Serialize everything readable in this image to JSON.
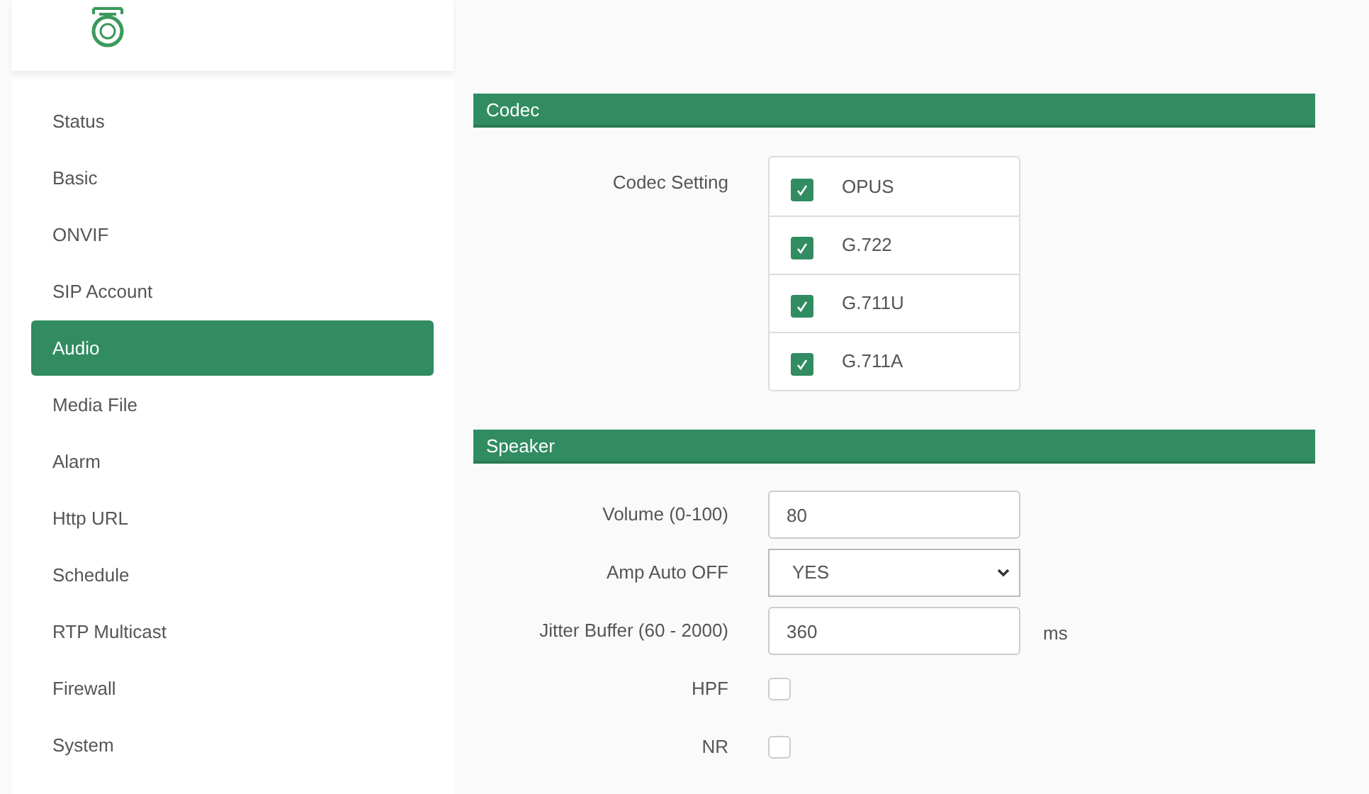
{
  "sidebar": {
    "items": [
      {
        "label": "Status",
        "selected": false
      },
      {
        "label": "Basic",
        "selected": false
      },
      {
        "label": "ONVIF",
        "selected": false
      },
      {
        "label": "SIP Account",
        "selected": false
      },
      {
        "label": "Audio",
        "selected": true
      },
      {
        "label": "Media File",
        "selected": false
      },
      {
        "label": "Alarm",
        "selected": false
      },
      {
        "label": "Http URL",
        "selected": false
      },
      {
        "label": "Schedule",
        "selected": false
      },
      {
        "label": "RTP Multicast",
        "selected": false
      },
      {
        "label": "Firewall",
        "selected": false
      },
      {
        "label": "System",
        "selected": false
      }
    ]
  },
  "codec": {
    "title": "Codec",
    "label": "Codec Setting",
    "options": [
      {
        "label": "OPUS",
        "checked": true
      },
      {
        "label": "G.722",
        "checked": true
      },
      {
        "label": "G.711U",
        "checked": true
      },
      {
        "label": "G.711A",
        "checked": true
      }
    ]
  },
  "speaker": {
    "title": "Speaker",
    "fields": [
      {
        "kind": "text",
        "label": "Volume (0-100)",
        "value": "80"
      },
      {
        "kind": "select",
        "label": "Amp Auto OFF",
        "value": "YES"
      },
      {
        "kind": "text",
        "label": "Jitter Buffer (60 - 2000)",
        "value": "360",
        "unit": "ms"
      },
      {
        "kind": "checkbox",
        "label": "HPF",
        "checked": false
      },
      {
        "kind": "checkbox",
        "label": "NR",
        "checked": false
      }
    ]
  }
}
